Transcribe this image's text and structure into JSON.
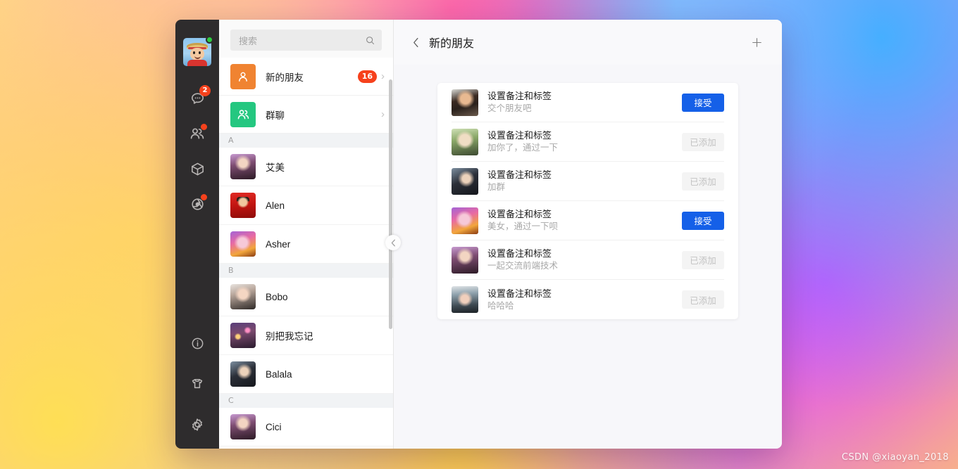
{
  "rail": {
    "avatar": {
      "name": "user-avatar",
      "status": "online"
    },
    "icons": [
      {
        "key": "chat",
        "name": "chat-bubble-icon",
        "badge": "2",
        "badge_type": "count"
      },
      {
        "key": "contacts",
        "name": "contacts-people-icon",
        "badge": "",
        "badge_type": "dot"
      },
      {
        "key": "collection",
        "name": "box-cube-icon",
        "badge": "",
        "badge_type": "none"
      },
      {
        "key": "moments",
        "name": "shutter-circle-icon",
        "badge": "",
        "badge_type": "dot"
      }
    ],
    "bottom_icons": [
      {
        "key": "info",
        "name": "info-circle-icon"
      },
      {
        "key": "theme",
        "name": "tshirt-theme-icon"
      },
      {
        "key": "settings",
        "name": "gear-settings-icon"
      }
    ]
  },
  "search": {
    "placeholder": "搜索",
    "value": "",
    "icon": "search-icon"
  },
  "contact_list": {
    "entries": [
      {
        "label": "新的朋友",
        "badge": "16",
        "tile_color": "#f08331",
        "icon": "single-person-icon"
      },
      {
        "label": "群聊",
        "badge": "",
        "tile_color": "#24c780",
        "icon": "group-people-icon"
      }
    ],
    "groups": [
      {
        "letter": "A",
        "contacts": [
          {
            "name": "艾美",
            "avatar": "ph-e"
          },
          {
            "name": "Alen",
            "avatar": "ph-red"
          },
          {
            "name": "Asher",
            "avatar": "ph-d"
          }
        ]
      },
      {
        "letter": "B",
        "contacts": [
          {
            "name": "Bobo",
            "avatar": "ph-g"
          },
          {
            "name": "别把我忘记",
            "avatar": "ph-night"
          },
          {
            "name": "Balala",
            "avatar": "ph-c"
          }
        ]
      },
      {
        "letter": "C",
        "contacts": [
          {
            "name": "Cici",
            "avatar": "ph-e"
          }
        ]
      }
    ]
  },
  "collapse_handle": {
    "icon": "chevron-left-icon"
  },
  "main": {
    "back_icon": "chevron-left-icon",
    "title": "新的朋友",
    "add_icon": "plus-icon",
    "requests": [
      {
        "title": "设置备注和标签",
        "message": "交个朋友吧",
        "action_label": "接受",
        "action_state": "accept",
        "avatar": "ph-a"
      },
      {
        "title": "设置备注和标签",
        "message": "加你了，通过一下",
        "action_label": "已添加",
        "action_state": "added",
        "avatar": "ph-b"
      },
      {
        "title": "设置备注和标签",
        "message": "加群",
        "action_label": "已添加",
        "action_state": "added",
        "avatar": "ph-c"
      },
      {
        "title": "设置备注和标签",
        "message": "美女，通过一下呗",
        "action_label": "接受",
        "action_state": "accept",
        "avatar": "ph-d"
      },
      {
        "title": "设置备注和标签",
        "message": "一起交流前端技术",
        "action_label": "已添加",
        "action_state": "added",
        "avatar": "ph-e"
      },
      {
        "title": "设置备注和标签",
        "message": "哈哈哈",
        "action_label": "已添加",
        "action_state": "added",
        "avatar": "ph-f"
      }
    ]
  },
  "watermark": "CSDN @xiaoyan_2018",
  "colors": {
    "accent_blue": "#1560e8",
    "badge_red": "#f6411c",
    "tile_orange": "#f08331",
    "tile_green": "#24c780",
    "rail_dark": "#2e2c2d",
    "online_green": "#2ecc40"
  }
}
